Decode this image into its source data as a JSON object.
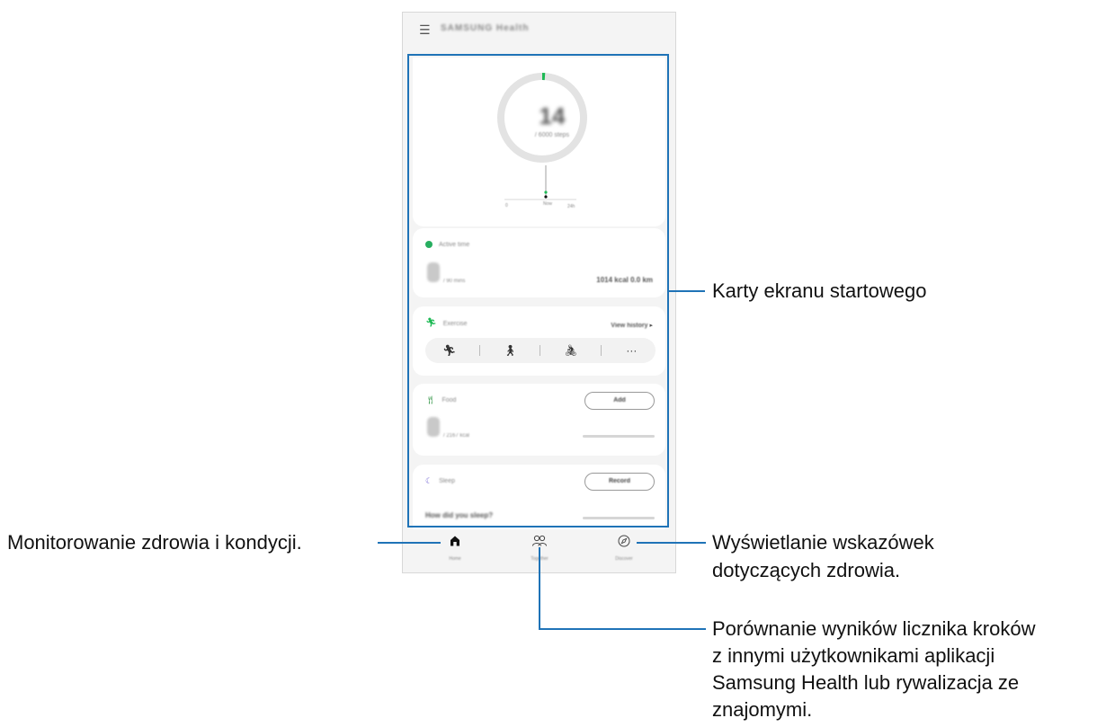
{
  "phone": {
    "app_title": "SAMSUNG Health",
    "steps": {
      "count": "14",
      "target": "/ 6000 steps",
      "graph_labels": [
        "0",
        "Now",
        "24h"
      ]
    },
    "active_time": {
      "title": "Active time",
      "unit": "/ 90 mins",
      "stats": "1014 kcal  0.0 km"
    },
    "exercise": {
      "title": "Exercise",
      "view_history": "View history",
      "activities": [
        "running-icon",
        "walking-icon",
        "cycling-icon",
        "more-icon"
      ]
    },
    "food": {
      "title": "Food",
      "button": "Add",
      "unit": "/ 2167 kcal"
    },
    "sleep": {
      "title": "Sleep",
      "button": "Record",
      "question": "How did you sleep?"
    },
    "nav": {
      "home": "Home",
      "together": "Together",
      "discover": "Discover"
    }
  },
  "callouts": {
    "home_cards": "Karty ekranu startowego",
    "monitoring": "Monitorowanie zdrowia i kondycji.",
    "tips_line1": "Wyświetlanie wskazówek",
    "tips_line2": "dotyczących zdrowia.",
    "compare_line1": "Porównanie wyników licznika kroków",
    "compare_line2": "z innymi użytkownikami aplikacji",
    "compare_line3": "Samsung Health lub rywalizacja ze",
    "compare_line4": "znajomymi."
  },
  "colors": {
    "callout_blue": "#1f73b7",
    "steps_green": "#1db954",
    "active_green": "#27ae60",
    "food_green": "#3a9a4d",
    "sleep_purple": "#7b6fd6"
  }
}
